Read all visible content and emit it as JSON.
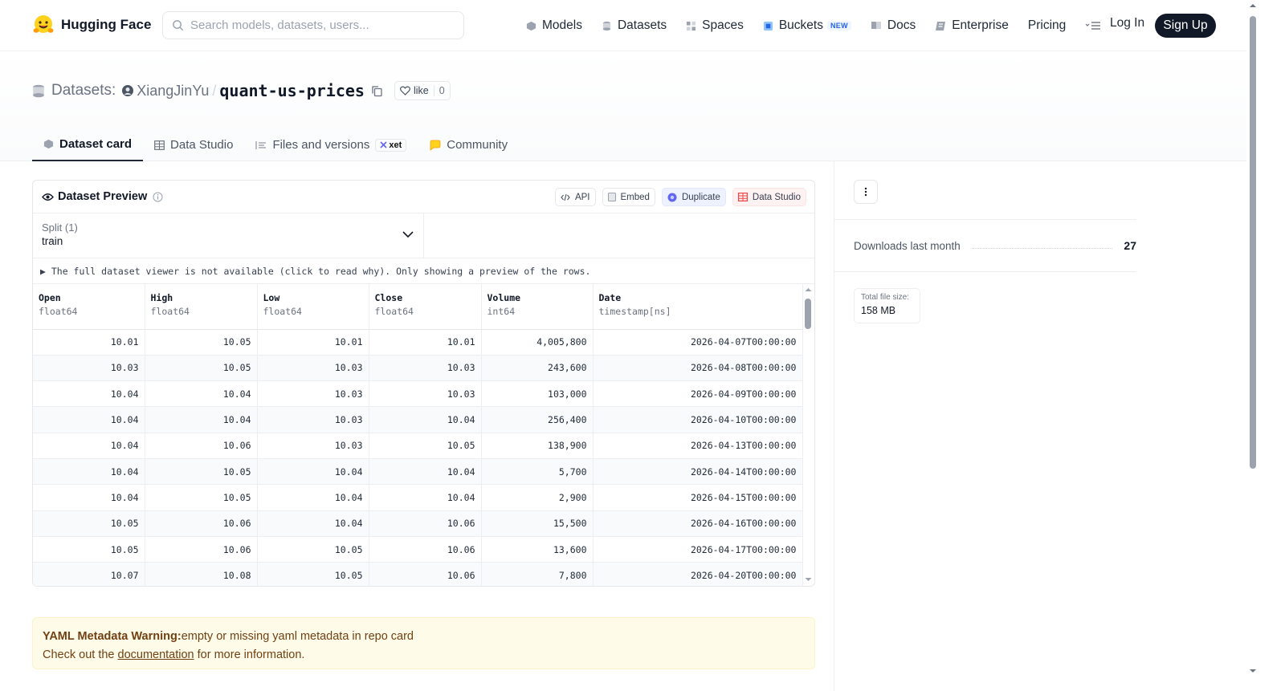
{
  "nav": {
    "brand": "Hugging Face",
    "search_placeholder": "Search models, datasets, users...",
    "links": [
      {
        "label": "Models",
        "icon": "models-icon"
      },
      {
        "label": "Datasets",
        "icon": "datasets-icon"
      },
      {
        "label": "Spaces",
        "icon": "spaces-icon"
      },
      {
        "label": "Buckets",
        "icon": "buckets-icon",
        "badge": "NEW"
      },
      {
        "label": "Docs",
        "icon": "docs-icon"
      },
      {
        "label": "Enterprise",
        "icon": "enterprise-icon"
      },
      {
        "label": "Pricing"
      }
    ],
    "login": "Log In",
    "signup": "Sign Up"
  },
  "header": {
    "section_label": "Datasets:",
    "user": "XiangJinYu",
    "separator": "/",
    "repo": "quant-us-prices",
    "like_label": "like",
    "like_count": "0"
  },
  "tabs": [
    {
      "label": "Dataset card",
      "active": true
    },
    {
      "label": "Data Studio"
    },
    {
      "label": "Files and versions",
      "badge": "xet"
    },
    {
      "label": "Community"
    }
  ],
  "preview": {
    "title": "Dataset Preview",
    "actions": {
      "api": "API",
      "embed": "Embed",
      "duplicate": "Duplicate",
      "data_studio": "Data Studio"
    },
    "split_label": "Split (1)",
    "split_value": "train",
    "notice": "▶ The full dataset viewer is not available (click to read why). Only showing a preview of the rows.",
    "columns": [
      {
        "name": "Open",
        "type": "float64"
      },
      {
        "name": "High",
        "type": "float64"
      },
      {
        "name": "Low",
        "type": "float64"
      },
      {
        "name": "Close",
        "type": "float64"
      },
      {
        "name": "Volume",
        "type": "int64"
      },
      {
        "name": "Date",
        "type": "timestamp[ns]"
      }
    ],
    "rows": [
      [
        "10.01",
        "10.05",
        "10.01",
        "10.01",
        "4,005,800",
        "2026-04-07T00:00:00"
      ],
      [
        "10.03",
        "10.05",
        "10.03",
        "10.03",
        "243,600",
        "2026-04-08T00:00:00"
      ],
      [
        "10.04",
        "10.04",
        "10.03",
        "10.03",
        "103,000",
        "2026-04-09T00:00:00"
      ],
      [
        "10.04",
        "10.04",
        "10.03",
        "10.04",
        "256,400",
        "2026-04-10T00:00:00"
      ],
      [
        "10.04",
        "10.06",
        "10.03",
        "10.05",
        "138,900",
        "2026-04-13T00:00:00"
      ],
      [
        "10.04",
        "10.05",
        "10.04",
        "10.04",
        "5,700",
        "2026-04-14T00:00:00"
      ],
      [
        "10.04",
        "10.05",
        "10.04",
        "10.04",
        "2,900",
        "2026-04-15T00:00:00"
      ],
      [
        "10.05",
        "10.06",
        "10.04",
        "10.06",
        "15,500",
        "2026-04-16T00:00:00"
      ],
      [
        "10.05",
        "10.06",
        "10.05",
        "10.06",
        "13,600",
        "2026-04-17T00:00:00"
      ],
      [
        "10.07",
        "10.08",
        "10.05",
        "10.06",
        "7,800",
        "2026-04-20T00:00:00"
      ]
    ]
  },
  "warning": {
    "strong": "YAML Metadata Warning:",
    "text": "empty or missing yaml metadata in repo card",
    "line2_pre": "Check out the ",
    "link": "documentation",
    "line2_post": " for more information."
  },
  "sidebar": {
    "downloads_label": "Downloads last month",
    "downloads_value": "27",
    "filesize_label": "Total file size:",
    "filesize_value": "158 MB"
  }
}
